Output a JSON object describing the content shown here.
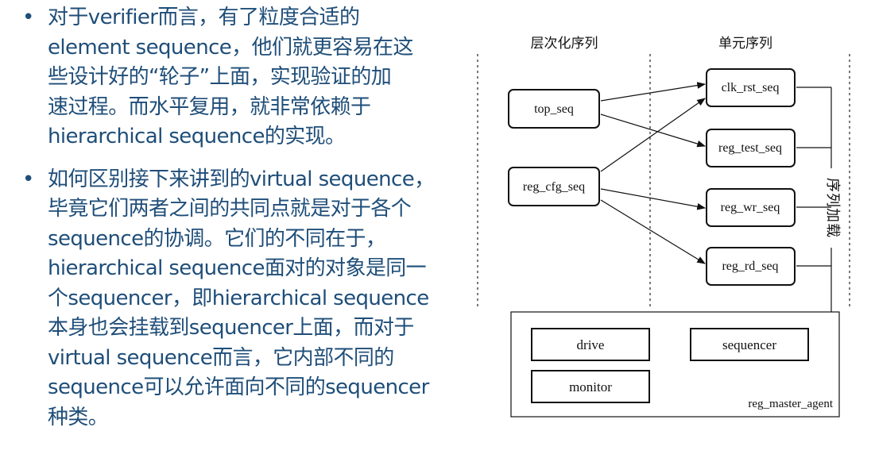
{
  "bullets": [
    {
      "marker": "•",
      "lines": [
        "对于verifier而言，有了粒度合适的",
        "element sequence，他们就更容易在这",
        "些设计好的“轮子”上面，实现验证的加",
        "速过程。而水平复用，就非常依赖于",
        "hierarchical sequence的实现。"
      ]
    },
    {
      "marker": "•",
      "lines": [
        "如何区别接下来讲到的virtual sequence，",
        "毕竟它们两者之间的共同点就是对于各个",
        "sequence的协调。它们的不同在于，",
        "hierarchical sequence面对的对象是同一",
        "个sequencer，即hierarchical sequence",
        "本身也会挂载到sequencer上面，而对于",
        "virtual sequence而言，它内部不同的",
        "sequence可以允许面向不同的sequencer",
        "种类。"
      ]
    }
  ],
  "diagram": {
    "headers": {
      "hierarchical": "层次化序列",
      "element": "单元序列"
    },
    "side_label": "序列加载",
    "hierarchical_nodes": [
      "top_seq",
      "reg_cfg_seq"
    ],
    "element_nodes": [
      "clk_rst_seq",
      "reg_test_seq",
      "reg_wr_seq",
      "reg_rd_seq"
    ],
    "agent": {
      "label": "reg_master_agent",
      "components": [
        "drive",
        "monitor",
        "sequencer"
      ]
    },
    "edges": [
      [
        "top_seq",
        "clk_rst_seq"
      ],
      [
        "top_seq",
        "reg_test_seq"
      ],
      [
        "reg_cfg_seq",
        "clk_rst_seq"
      ],
      [
        "reg_cfg_seq",
        "reg_wr_seq"
      ],
      [
        "reg_cfg_seq",
        "reg_rd_seq"
      ]
    ]
  },
  "colors": {
    "text": "#1f4e79",
    "diagram": "#111111"
  }
}
